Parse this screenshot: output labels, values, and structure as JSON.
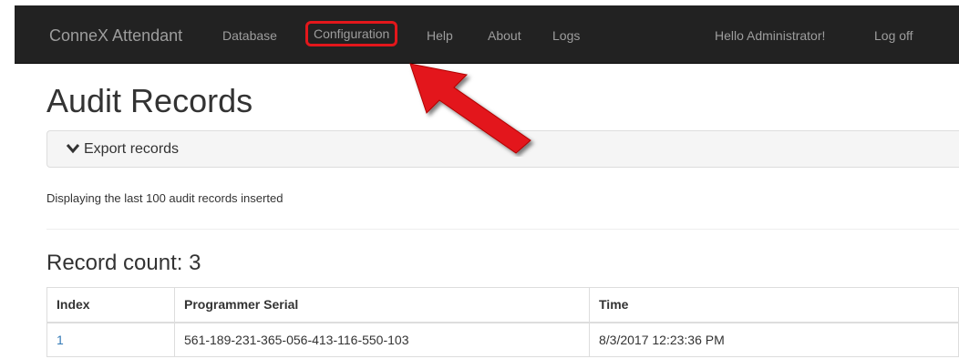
{
  "navbar": {
    "brand": "ConneX Attendant",
    "links": [
      "Database",
      "Configuration",
      "Help",
      "About",
      "Logs"
    ],
    "greeting": "Hello Administrator!",
    "logoff": "Log off"
  },
  "page": {
    "title": "Audit Records",
    "export_label": "Export records",
    "info": "Displaying the last 100 audit records inserted",
    "record_count": "Record count: 3"
  },
  "table": {
    "headers": [
      "Index",
      "Programmer Serial",
      "Time"
    ],
    "rows": [
      {
        "index": "1",
        "serial": "561-189-231-365-056-413-116-550-103",
        "time": "8/3/2017 12:23:36 PM"
      }
    ]
  },
  "colors": {
    "navbar": "#222222",
    "highlight": "#e3171b",
    "link": "#337ab7"
  }
}
